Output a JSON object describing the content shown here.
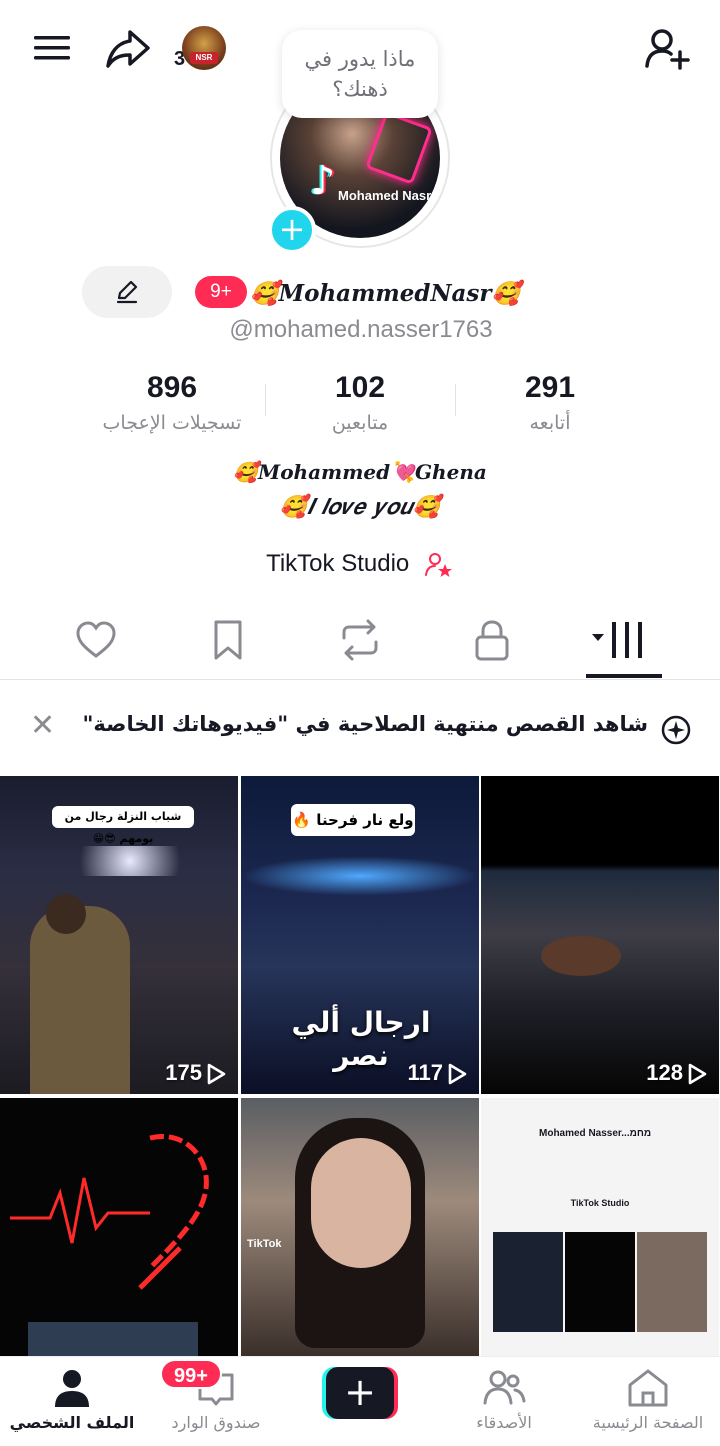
{
  "header": {
    "badge_count": "3",
    "mini_avatar_text": "NSR",
    "thought_bubble": "ماذا يدور في ذهنك؟"
  },
  "profile": {
    "avatar_name": "Mohamed Nasr",
    "notification_badge": "9+",
    "display_name": "🥰𝑴𝒐𝒉𝒂𝒎𝒎𝒆𝒅𝑵𝒂𝒔𝒓🥰",
    "username": "@mohamed.nasser1763"
  },
  "stats": {
    "likes": {
      "value": "896",
      "label": "تسجيلات الإعجاب"
    },
    "followers": {
      "value": "102",
      "label": "متابعين"
    },
    "following": {
      "value": "291",
      "label": "أتابعه"
    }
  },
  "bio": {
    "line1": "🥰𝑴𝒐𝒉𝒂𝒎𝒎𝒆𝒅💘𝑮𝒉𝒆𝒏𝒂",
    "line2": "🥰𝑰 𝒍𝒐𝒗𝒆 𝒚𝒐𝒖🥰"
  },
  "studio": {
    "label": "TikTok Studio"
  },
  "notice": {
    "text": "شاهد القصص منتهية الصلاحية في \"فيديوهاتك الخاصة\""
  },
  "videos": [
    {
      "views": "175",
      "caption": "شباب النزلة رجال من يومهم 😎😁"
    },
    {
      "views": "117",
      "caption": "ولع نار فرحنا 🔥",
      "overlay": "ارجال ألي نصر"
    },
    {
      "views": "128"
    },
    {},
    {
      "watermark": "TikTok"
    },
    {
      "mini_name": "Mohamed Nasser...מחמ",
      "mini_studio": "TikTok Studio"
    }
  ],
  "nav": {
    "home": "الصفحة الرئيسية",
    "friends": "الأصدقاء",
    "inbox": "صندوق الوارد",
    "inbox_badge": "99+",
    "profile": "الملف الشخصي"
  },
  "colors": {
    "accent": "#fe2c55",
    "cyan": "#25f4ee",
    "plus_badge": "#20d5ec"
  }
}
